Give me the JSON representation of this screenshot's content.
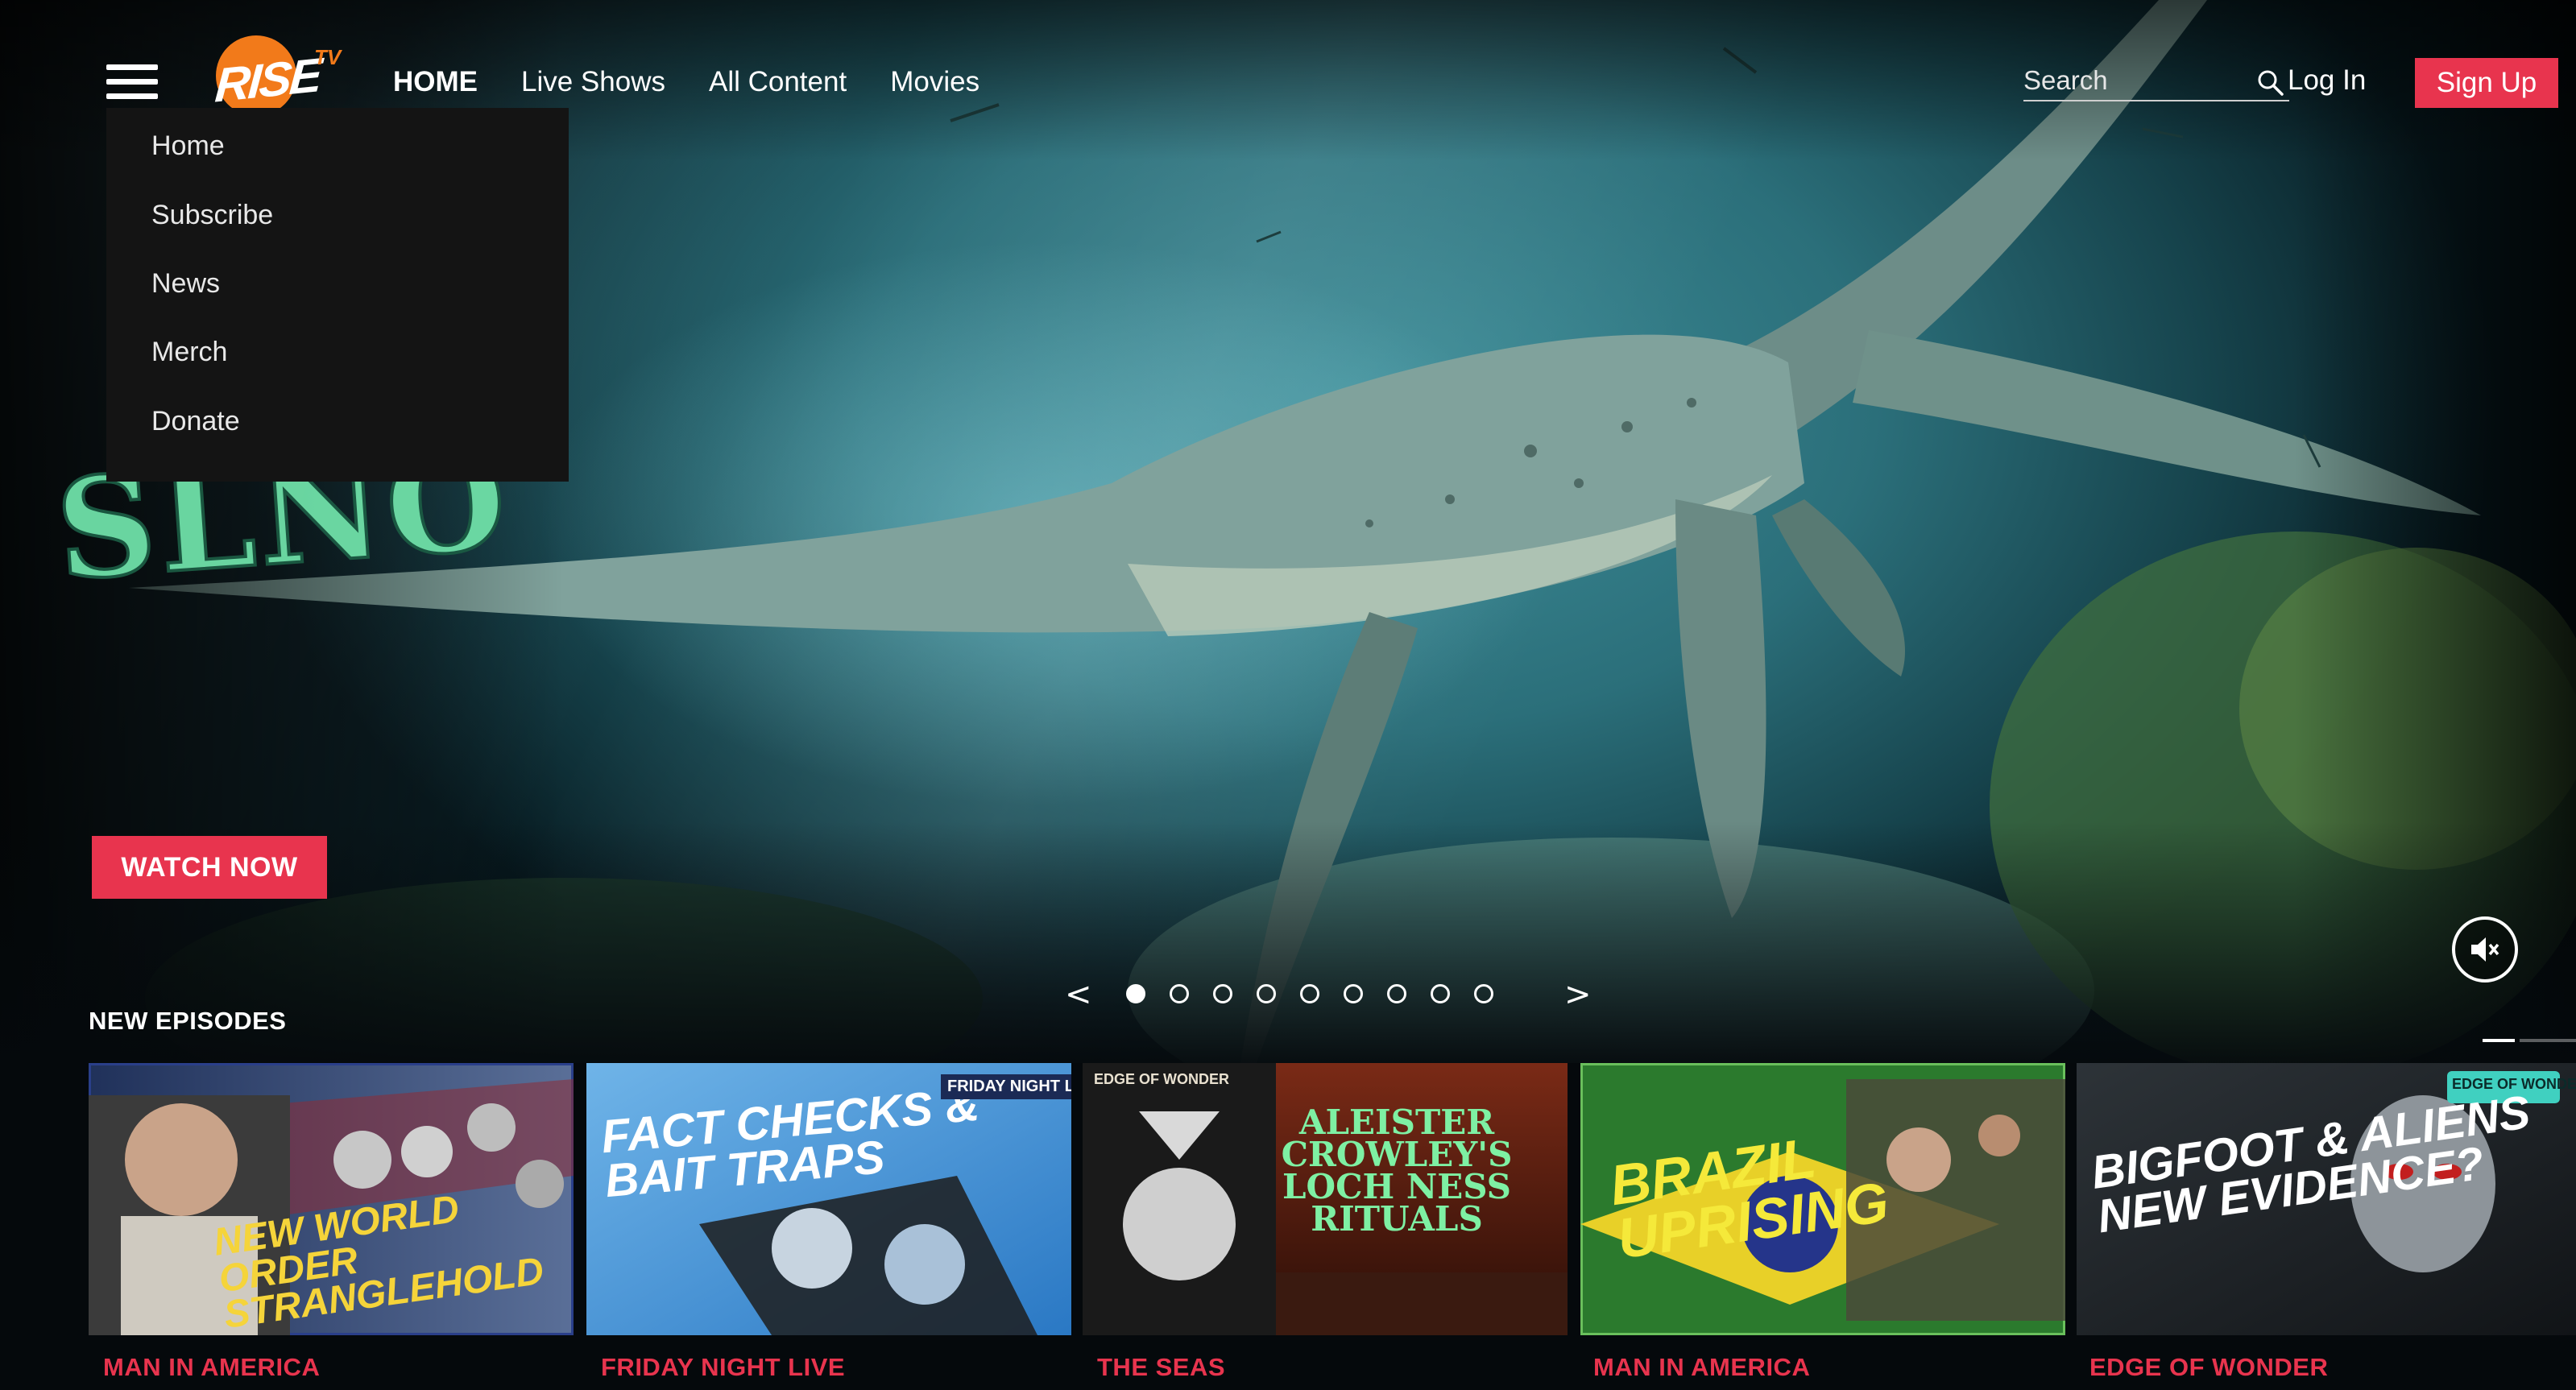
{
  "header": {
    "nav": [
      {
        "label": "HOME",
        "active": true
      },
      {
        "label": "Live Shows",
        "active": false
      },
      {
        "label": "All Content",
        "active": false
      },
      {
        "label": "Movies",
        "active": false
      }
    ],
    "search_placeholder": "Search",
    "login_label": "Log In",
    "signup_label": "Sign Up",
    "logo_text": "RISE",
    "logo_sup": "TV"
  },
  "menu": {
    "items": [
      "Home",
      "Subscribe",
      "News",
      "Merch",
      "Donate"
    ]
  },
  "hero": {
    "watch_now_label": "WATCH NOW",
    "show_logo_fragment": "SLNO",
    "prev_arrow": "<",
    "next_arrow": ">",
    "slide_count": 9,
    "active_slide": 1
  },
  "episodes": {
    "section_title": "NEW EPISODES",
    "items": [
      {
        "headline": "NEW WORLD ORDER STRANGLEHOLD",
        "show": "MAN IN AMERICA",
        "badge": ""
      },
      {
        "headline": "FACT CHECKS & BAIT TRAPS",
        "show": "FRIDAY NIGHT LIVE",
        "badge": "FRIDAY NIGHT LIVE"
      },
      {
        "headline": "ALEISTER CROWLEY'S LOCH NESS RITUALS",
        "show": "THE SEAS",
        "badge": "EDGE OF WONDER"
      },
      {
        "headline": "BRAZIL UPRISING",
        "show": "MAN IN AMERICA",
        "badge": ""
      },
      {
        "headline": "BIGFOOT & ALIENS NEW EVIDENCE?",
        "show": "EDGE OF WONDER",
        "badge": "EDGE OF WONDER"
      }
    ]
  },
  "colors": {
    "accent": "#e8344e",
    "logo_orange": "#f27a1a",
    "menu_bg": "#141414"
  },
  "icons": [
    "hamburger-icon",
    "search-icon",
    "mute-icon"
  ]
}
